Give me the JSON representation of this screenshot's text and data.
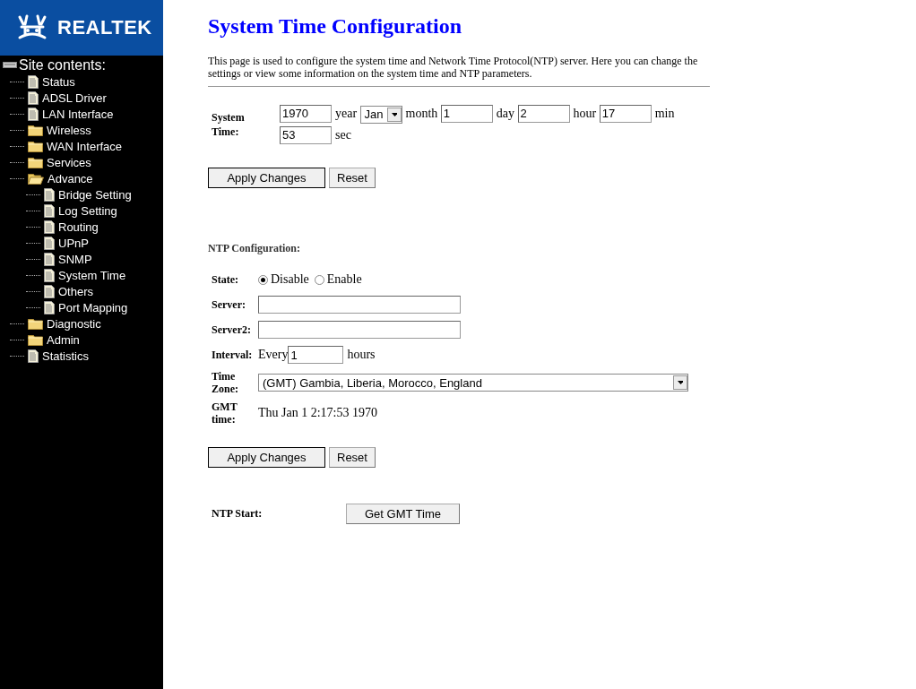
{
  "logo": {
    "text": "REALTEK"
  },
  "sidebar": {
    "title": "Site contents:",
    "items": [
      {
        "label": "Status",
        "kind": "page"
      },
      {
        "label": "ADSL Driver",
        "kind": "page"
      },
      {
        "label": "LAN Interface",
        "kind": "page"
      },
      {
        "label": "Wireless",
        "kind": "folder",
        "expanded": false
      },
      {
        "label": "WAN Interface",
        "kind": "folder",
        "expanded": false
      },
      {
        "label": "Services",
        "kind": "folder",
        "expanded": false
      },
      {
        "label": "Advance",
        "kind": "folder",
        "expanded": true,
        "children": [
          {
            "label": "Bridge Setting",
            "kind": "page"
          },
          {
            "label": "Log Setting",
            "kind": "page"
          },
          {
            "label": "Routing",
            "kind": "page"
          },
          {
            "label": "UPnP",
            "kind": "page"
          },
          {
            "label": "SNMP",
            "kind": "page"
          },
          {
            "label": "System Time",
            "kind": "page"
          },
          {
            "label": "Others",
            "kind": "page"
          },
          {
            "label": "Port Mapping",
            "kind": "page"
          }
        ]
      },
      {
        "label": "Diagnostic",
        "kind": "folder",
        "expanded": false
      },
      {
        "label": "Admin",
        "kind": "folder",
        "expanded": false
      },
      {
        "label": "Statistics",
        "kind": "page"
      }
    ]
  },
  "title": "System Time Configuration",
  "description": "This page is used to configure the system time and Network Time Protocol(NTP) server. Here you can change the settings or view some information on the system time and NTP parameters.",
  "system_time": {
    "label": "System Time:",
    "fields": [
      {
        "kind": "input",
        "value": "1970",
        "unit": "year"
      },
      {
        "kind": "select",
        "value": "Jan",
        "unit": "month"
      },
      {
        "kind": "input",
        "value": "1",
        "unit": "day"
      },
      {
        "kind": "input",
        "value": "2",
        "unit": "hour"
      },
      {
        "kind": "input",
        "value": "17",
        "unit": "min"
      },
      {
        "kind": "input",
        "value": "53",
        "unit": "sec"
      }
    ]
  },
  "buttons": [
    "Apply Changes",
    "Reset"
  ],
  "ntp": {
    "title": "NTP Configuration:",
    "state": {
      "label": "State:",
      "options": [
        {
          "label": "Disable",
          "selected": true
        },
        {
          "label": "Enable",
          "selected": false
        }
      ]
    },
    "server": {
      "label": "Server:"
    },
    "server2": {
      "label": "Server2:"
    },
    "interval": {
      "label": "Interval:",
      "prefix": "Every",
      "value": "1",
      "unit": "hours"
    },
    "time_zone": {
      "label": "Time Zone:",
      "value": "(GMT) Gambia, Liberia, Morocco, England"
    },
    "gmt_time": {
      "label": "GMT time:",
      "value": "Thu Jan 1 2:17:53 1970"
    },
    "buttons": [
      "Apply Changes",
      "Reset"
    ]
  },
  "ntp_start": {
    "label": "NTP Start:",
    "button": "Get GMT Time"
  }
}
